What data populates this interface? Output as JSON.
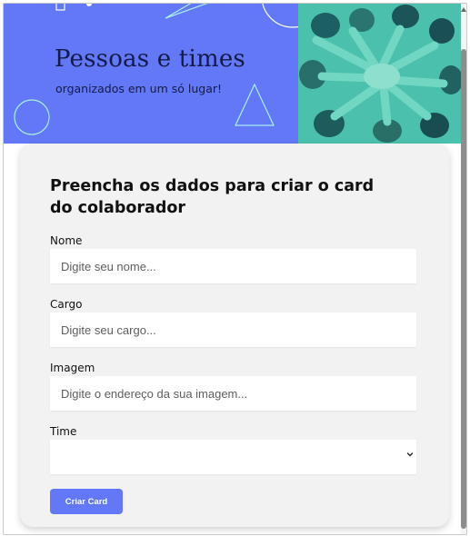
{
  "banner": {
    "title": "Pessoas e times",
    "subtitle": "organizados em um só lugar!"
  },
  "form": {
    "heading": "Preencha os dados para criar o card do colaborador",
    "fields": [
      {
        "label": "Nome",
        "placeholder": "Digite seu nome..."
      },
      {
        "label": "Cargo",
        "placeholder": "Digite seu cargo..."
      },
      {
        "label": "Imagem",
        "placeholder": "Digite o endereço da sua imagem..."
      }
    ],
    "team": {
      "label": "Time",
      "selected": ""
    },
    "submit_label": "Criar Card"
  },
  "colors": {
    "accent": "#6278f7",
    "photo_tint": "#5fe0c4",
    "card_background": "#f2f2f2"
  }
}
